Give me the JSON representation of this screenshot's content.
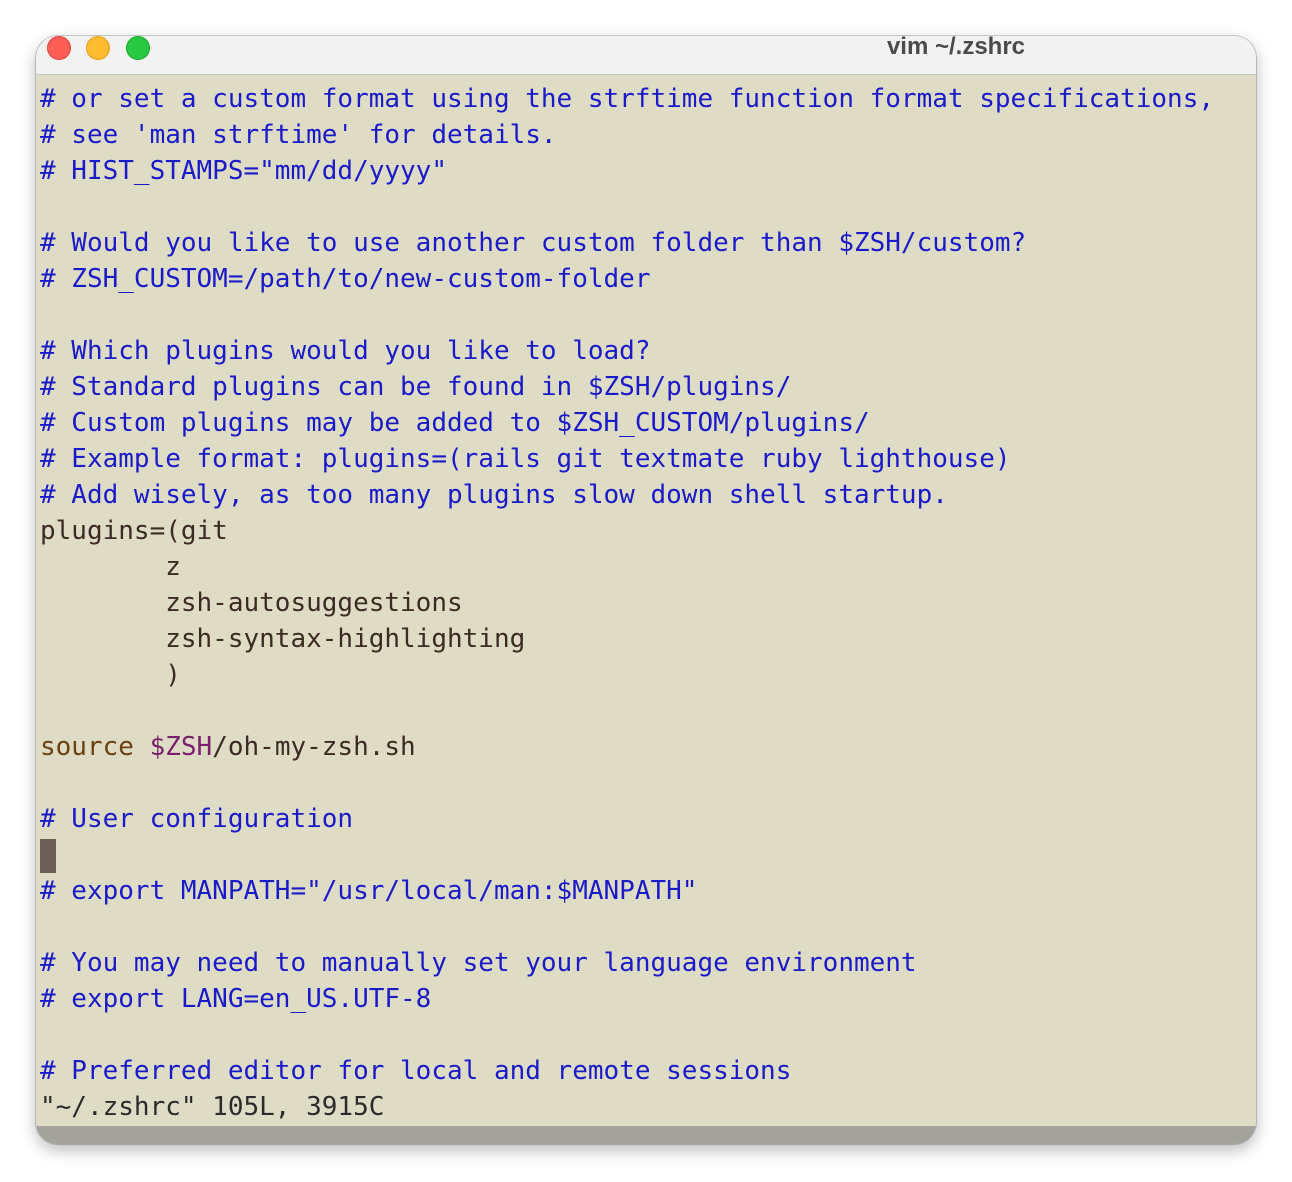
{
  "window": {
    "title": "vim ~/.zshrc"
  },
  "colors": {
    "background": "#dfdcc6",
    "comment": "#1a1ac8",
    "keyword": "#6e3f0f",
    "variable": "#7a1f6b",
    "text": "#3b2b22"
  },
  "editor": {
    "lines": {
      "l1": "# or set a custom format using the strftime function format specifications,",
      "l2": "# see 'man strftime' for details.",
      "l3": "# HIST_STAMPS=\"mm/dd/yyyy\"",
      "l4": "",
      "l5": "# Would you like to use another custom folder than $ZSH/custom?",
      "l6": "# ZSH_CUSTOM=/path/to/new-custom-folder",
      "l7": "",
      "l8": "# Which plugins would you like to load?",
      "l9": "# Standard plugins can be found in $ZSH/plugins/",
      "l10": "# Custom plugins may be added to $ZSH_CUSTOM/plugins/",
      "l11": "# Example format: plugins=(rails git textmate ruby lighthouse)",
      "l12": "# Add wisely, as too many plugins slow down shell startup.",
      "l13": "plugins=(git",
      "l14": "        z",
      "l15": "        zsh-autosuggestions",
      "l16": "        zsh-syntax-highlighting",
      "l17": "        )",
      "l18": "",
      "l19_kw": "source",
      "l19_sp": " ",
      "l19_var": "$ZSH",
      "l19_rest": "/oh-my-zsh.sh",
      "l20": "",
      "l21": "# User configuration",
      "l22": "",
      "l23": "# export MANPATH=\"/usr/local/man:$MANPATH\"",
      "l24": "",
      "l25": "# You may need to manually set your language environment",
      "l26": "# export LANG=en_US.UTF-8",
      "l27": "",
      "l28": "# Preferred editor for local and remote sessions"
    },
    "status_line": "\"~/.zshrc\" 105L, 3915C"
  }
}
